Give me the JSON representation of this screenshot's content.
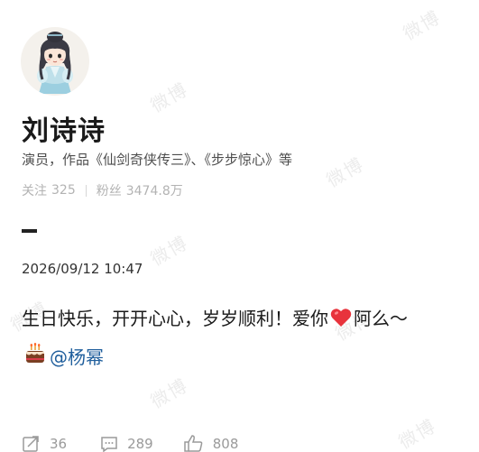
{
  "watermark_text": "微博",
  "profile": {
    "avatar_icon": "chibi-costume-avatar",
    "name": "刘诗诗",
    "bio": "演员，作品《仙剑奇侠传三》、《步步惊心》等",
    "following_label": "关注",
    "following_count": "325",
    "fans_label": "粉丝",
    "fans_count": "3474.8万"
  },
  "post": {
    "timestamp": "2026/09/12 10:47",
    "text_before_heart": "生日快乐，开开心心，岁岁顺利！爱你",
    "heart_icon": "red-heart-icon",
    "text_after_heart": "阿么～",
    "cake_icon": "birthday-cake-icon",
    "mention": "@杨幂"
  },
  "actions": {
    "share_icon": "share-icon",
    "share_count": "36",
    "comment_icon": "comment-icon",
    "comment_count": "289",
    "like_icon": "thumbs-up-icon",
    "like_count": "808"
  },
  "colors": {
    "mention": "#1f5e9c",
    "heart": "#e8333c",
    "muted": "#b3b3b3"
  }
}
